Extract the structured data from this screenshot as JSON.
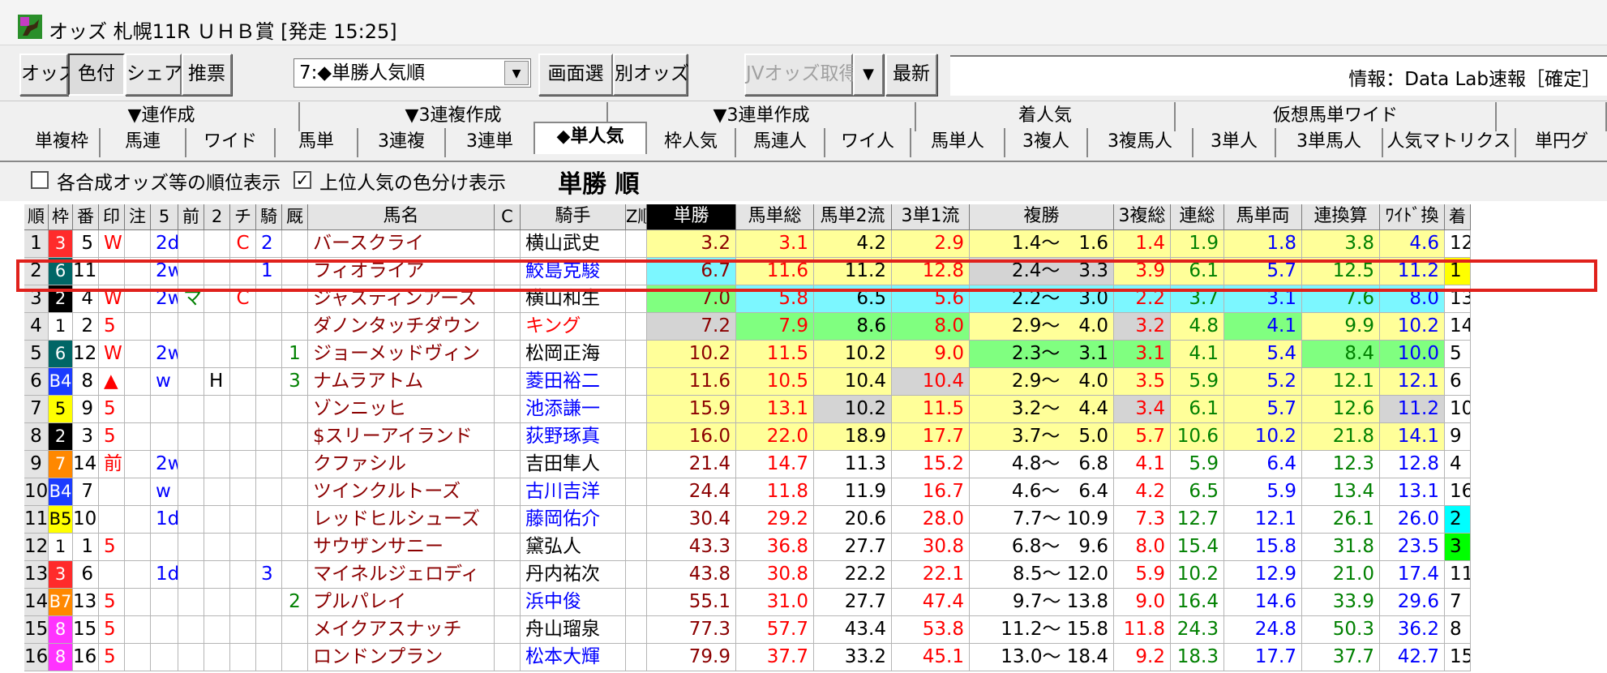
{
  "window": {
    "title": "オッズ 札幌11R ＵＨＢ賞 [発走 15:25]"
  },
  "toolbar": {
    "buttons": [
      "オッズ",
      "色付",
      "シェア",
      "推票"
    ],
    "select_value": "7:◆単勝人気順",
    "screen_select": "画面選",
    "separate_odds": "別オッズ",
    "jv_fetch": "JVオッズ取得",
    "refresh": "最新",
    "info": "情報：Data Lab速報［確定］"
  },
  "tabs": {
    "top": [
      "▼連作成",
      "▼3連複作成",
      "▼3連単作成",
      "着人気",
      "仮想馬単ワイド"
    ],
    "bottom": [
      "単複枠",
      "馬連",
      "ワイド",
      "馬単",
      "3連複",
      "3連単",
      "◆単人気",
      "枠人気",
      "馬連人",
      "ワイ人",
      "馬単人",
      "3複人",
      "3複馬人",
      "3単人",
      "3単馬人",
      "人気マトリクス",
      "単円グ"
    ]
  },
  "options": {
    "rank_display": "各合成オッズ等の順位表示",
    "rank_checked": false,
    "color_display": "上位人気の色分け表示",
    "color_checked": true,
    "sort_title": "単勝 順"
  },
  "table": {
    "headers": [
      "順",
      "枠",
      "番",
      "印",
      "注",
      "5",
      "前",
      "2",
      "チ",
      "騎",
      "厩",
      "馬名",
      "C",
      "騎手",
      "Z順",
      "単勝",
      "馬単総",
      "馬単2流",
      "3単1流",
      "複勝",
      "3複総",
      "連総",
      "馬単両",
      "連換算",
      "ﾜｲﾄﾞ換",
      "着"
    ],
    "rows": [
      [
        "1",
        "3",
        "5",
        "W",
        "",
        "2d",
        "",
        "",
        "C",
        "2",
        "",
        "バースクライ",
        "",
        "横山武史",
        "",
        "3.2",
        "3.1",
        "4.2",
        "2.9",
        "1.4～　1.6",
        "1.4",
        "1.9",
        "1.8",
        "3.8",
        "4.6",
        "12"
      ],
      [
        "2",
        "6",
        "11",
        "",
        "",
        "2w",
        "",
        "",
        "",
        "1",
        "",
        "フィオライア",
        "",
        "鮫島克駿",
        "",
        "6.7",
        "11.6",
        "11.2",
        "12.8",
        "2.4～　3.3",
        "3.9",
        "6.1",
        "5.7",
        "12.5",
        "11.2",
        "1"
      ],
      [
        "3",
        "2",
        "4",
        "W",
        "",
        "2w",
        "マ",
        "",
        "C",
        "",
        "",
        "ジャスティンアース",
        "",
        "横山和生",
        "",
        "7.0",
        "5.8",
        "6.5",
        "5.6",
        "2.2～　3.0",
        "2.2",
        "3.7",
        "3.1",
        "7.6",
        "8.0",
        "13"
      ],
      [
        "4",
        "1",
        "2",
        "5",
        "",
        "",
        "",
        "",
        "",
        "",
        "",
        "ダノンタッチダウン",
        "",
        "キング",
        "",
        "7.2",
        "7.9",
        "8.6",
        "8.0",
        "2.9～　4.0",
        "3.2",
        "4.8",
        "4.1",
        "9.9",
        "10.2",
        "14"
      ],
      [
        "5",
        "6",
        "12",
        "W",
        "",
        "2w",
        "",
        "",
        "",
        "",
        "1",
        "ジョーメッドヴィン",
        "",
        "松岡正海",
        "",
        "10.2",
        "11.5",
        "10.2",
        "9.0",
        "2.3～　3.1",
        "3.1",
        "4.1",
        "5.4",
        "8.4",
        "10.0",
        "5"
      ],
      [
        "6",
        "B4",
        "8",
        "▲",
        "",
        "w",
        "",
        "H",
        "",
        "",
        "3",
        "ナムラアトム",
        "",
        "菱田裕二",
        "",
        "11.6",
        "10.5",
        "10.4",
        "10.4",
        "2.9～　4.0",
        "3.5",
        "5.9",
        "5.2",
        "12.1",
        "12.1",
        "6"
      ],
      [
        "7",
        "5",
        "9",
        "5",
        "",
        "",
        "",
        "",
        "",
        "",
        "",
        "ゾンニッヒ",
        "",
        "池添謙一",
        "",
        "15.9",
        "13.1",
        "10.2",
        "11.5",
        "3.2～　4.4",
        "3.4",
        "6.1",
        "5.7",
        "12.6",
        "11.2",
        "10"
      ],
      [
        "8",
        "2",
        "3",
        "5",
        "",
        "",
        "",
        "",
        "",
        "",
        "",
        "$スリーアイランド",
        "",
        "荻野琢真",
        "",
        "16.0",
        "22.0",
        "18.9",
        "17.7",
        "3.7～　5.0",
        "5.7",
        "10.6",
        "10.2",
        "21.8",
        "14.1",
        "9"
      ],
      [
        "9",
        "7",
        "14",
        "前",
        "",
        "2w",
        "",
        "",
        "",
        "",
        "",
        "クファシル",
        "",
        "吉田隼人",
        "",
        "21.4",
        "14.7",
        "11.3",
        "15.2",
        "4.8～　6.8",
        "4.1",
        "5.9",
        "6.4",
        "12.3",
        "12.8",
        "4"
      ],
      [
        "10",
        "B4",
        "7",
        "",
        "",
        "w",
        "",
        "",
        "",
        "",
        "",
        "ツインクルトーズ",
        "",
        "古川吉洋",
        "",
        "24.4",
        "11.8",
        "11.9",
        "16.7",
        "4.6～　6.4",
        "4.2",
        "6.5",
        "5.9",
        "13.4",
        "13.1",
        "16"
      ],
      [
        "11",
        "B5",
        "10",
        "",
        "",
        "1d",
        "",
        "",
        "",
        "",
        "",
        "レッドヒルシューズ",
        "",
        "藤岡佑介",
        "",
        "30.4",
        "29.2",
        "20.6",
        "28.0",
        "7.7～ 10.9",
        "7.3",
        "12.7",
        "12.1",
        "26.1",
        "26.0",
        "2"
      ],
      [
        "12",
        "1",
        "1",
        "5",
        "",
        "",
        "",
        "",
        "",
        "",
        "",
        "サウザンサニー",
        "",
        "黛弘人",
        "",
        "43.3",
        "36.8",
        "27.7",
        "30.8",
        "6.8～　9.6",
        "8.0",
        "15.4",
        "15.8",
        "31.8",
        "23.5",
        "3"
      ],
      [
        "13",
        "3",
        "6",
        "",
        "",
        "1d",
        "",
        "",
        "",
        "3",
        "",
        "マイネルジェロディ",
        "",
        "丹内祐次",
        "",
        "43.8",
        "30.8",
        "22.2",
        "22.1",
        "8.5～ 12.0",
        "5.9",
        "10.2",
        "12.9",
        "21.0",
        "17.4",
        "11"
      ],
      [
        "14",
        "B7",
        "13",
        "5",
        "",
        "",
        "",
        "",
        "",
        "",
        "2",
        "プルパレイ",
        "",
        "浜中俊",
        "",
        "55.1",
        "31.0",
        "27.7",
        "47.4",
        "9.7～ 13.8",
        "9.0",
        "16.4",
        "14.6",
        "33.9",
        "29.6",
        "7"
      ],
      [
        "15",
        "8",
        "15",
        "5",
        "",
        "",
        "",
        "",
        "",
        "",
        "",
        "メイクアスナッチ",
        "",
        "舟山瑠泉",
        "",
        "77.3",
        "57.7",
        "43.4",
        "53.8",
        "11.2～ 15.8",
        "11.8",
        "24.3",
        "24.8",
        "50.3",
        "36.2",
        "8"
      ],
      [
        "16",
        "8",
        "16",
        "5",
        "",
        "",
        "",
        "",
        "",
        "",
        "",
        "ロンドンプラン",
        "",
        "松本大輝",
        "",
        "79.9",
        "37.7",
        "33.2",
        "45.1",
        "13.0～ 18.4",
        "9.2",
        "18.3",
        "17.7",
        "37.7",
        "42.7",
        "15"
      ]
    ]
  },
  "colors": {
    "waku": {
      "1": "#ffffff",
      "2": "#000000",
      "3": "#ff2b2b",
      "4": "#2d3cff",
      "5": "#ffff00",
      "6": "#006666",
      "7": "#ff8800",
      "8": "#ff33ff",
      "B4": "#1b3cff",
      "B5": "#ffff00",
      "B7": "#ff8800"
    },
    "yellow_cell": "#ffff99",
    "cyan_cell": "#7cf7ff",
    "green_cell": "#80ff80",
    "gray_cell": "#d4d4d4",
    "name_color": "#8b0000",
    "jockey_blue": "#0000ff",
    "jockey_red": "#ff0000",
    "highlight": "#e0211c"
  }
}
